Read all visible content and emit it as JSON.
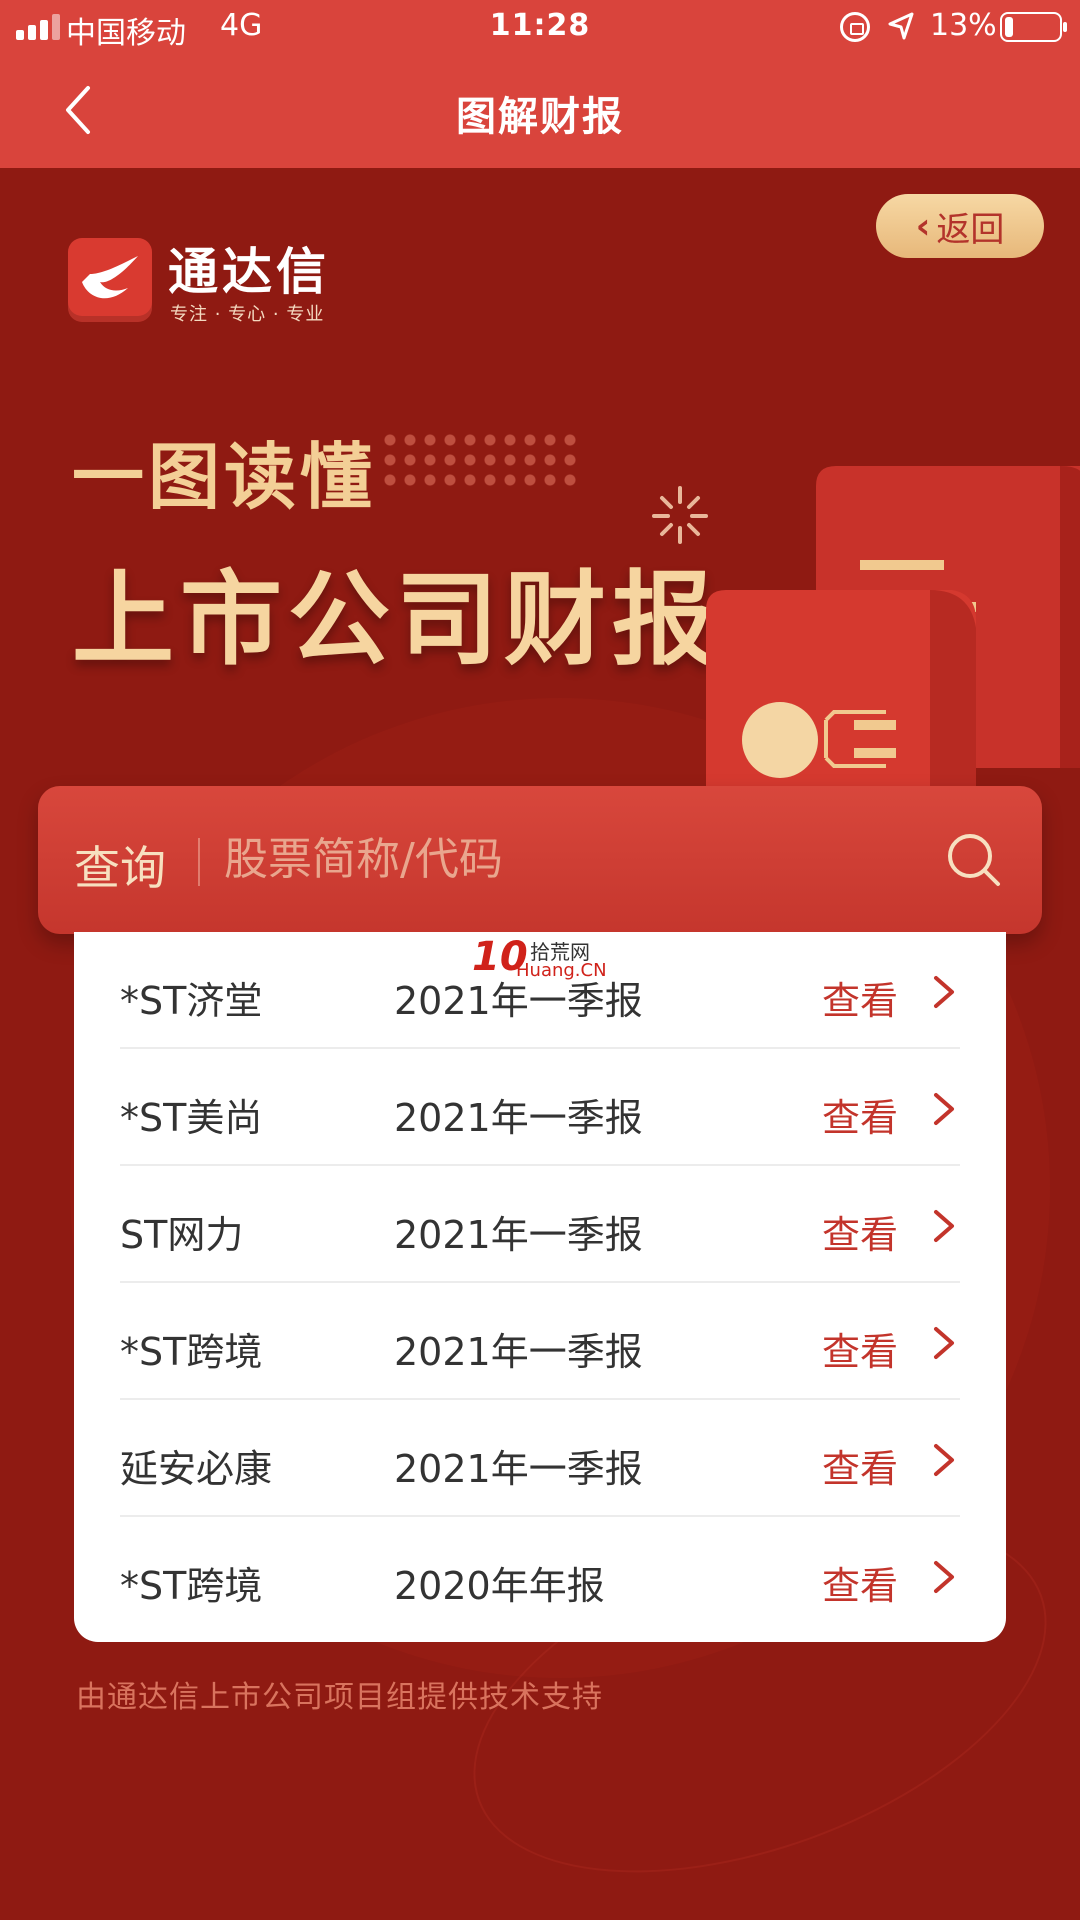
{
  "status": {
    "carrier": "中国移动",
    "network": "4G",
    "time": "11:28",
    "battery": "13%",
    "battery_level": 0.13
  },
  "nav": {
    "title": "图解财报"
  },
  "hero": {
    "back_label": "返回",
    "brand_name": "通达信",
    "brand_slogan": "专注 · 专心 · 专业",
    "headline1": "一图读懂",
    "headline2": "上市公司财报"
  },
  "search": {
    "label": "查询",
    "placeholder": "股票简称/代码"
  },
  "watermark": {
    "big": "10",
    "line1": "拾荒网",
    "line2": "Huang.CN"
  },
  "reports": [
    {
      "name": "*ST济堂",
      "period": "2021年一季报",
      "action": "查看"
    },
    {
      "name": "*ST美尚",
      "period": "2021年一季报",
      "action": "查看"
    },
    {
      "name": "ST网力",
      "period": "2021年一季报",
      "action": "查看"
    },
    {
      "name": "*ST跨境",
      "period": "2021年一季报",
      "action": "查看"
    },
    {
      "name": "延安必康",
      "period": "2021年一季报",
      "action": "查看"
    },
    {
      "name": "*ST跨境",
      "period": "2020年年报",
      "action": "查看"
    }
  ],
  "footer": {
    "note": "由通达信上市公司项目组提供技术支持"
  },
  "colors": {
    "nav_bg": "#d9443c",
    "page_bg": "#8f1a12",
    "accent": "#c3342b",
    "gold": "#f6d5a0"
  }
}
